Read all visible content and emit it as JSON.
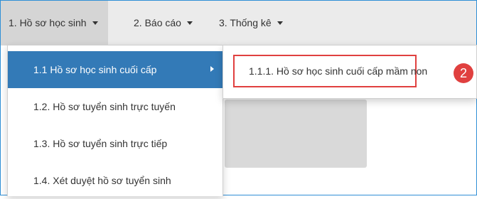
{
  "colors": {
    "accent": "#337ab7",
    "highlight_border": "#e0403f",
    "navbar_bg": "#ebebeb"
  },
  "navbar": {
    "items": [
      {
        "label": "1. Hồ sơ học sinh",
        "has_dropdown": true,
        "active": true
      },
      {
        "label": "2. Báo cáo",
        "has_dropdown": true,
        "active": false
      },
      {
        "label": "3. Thống kê",
        "has_dropdown": true,
        "active": false
      }
    ]
  },
  "dropdown": {
    "items": [
      {
        "label": "1.1 Hồ sơ học sinh cuối cấp",
        "selected": true,
        "has_submenu": true
      },
      {
        "label": "1.2. Hồ sơ tuyển sinh trực tuyến",
        "selected": false,
        "has_submenu": false
      },
      {
        "label": "1.3. Hồ sơ tuyển sinh trực tiếp",
        "selected": false,
        "has_submenu": false
      },
      {
        "label": "1.4. Xét duyệt hồ sơ tuyển sinh",
        "selected": false,
        "has_submenu": false
      }
    ]
  },
  "submenu": {
    "items": [
      {
        "label": "1.1.1. Hồ sơ học sinh cuối cấp mầm non"
      }
    ]
  },
  "annotation": {
    "step": "2"
  }
}
